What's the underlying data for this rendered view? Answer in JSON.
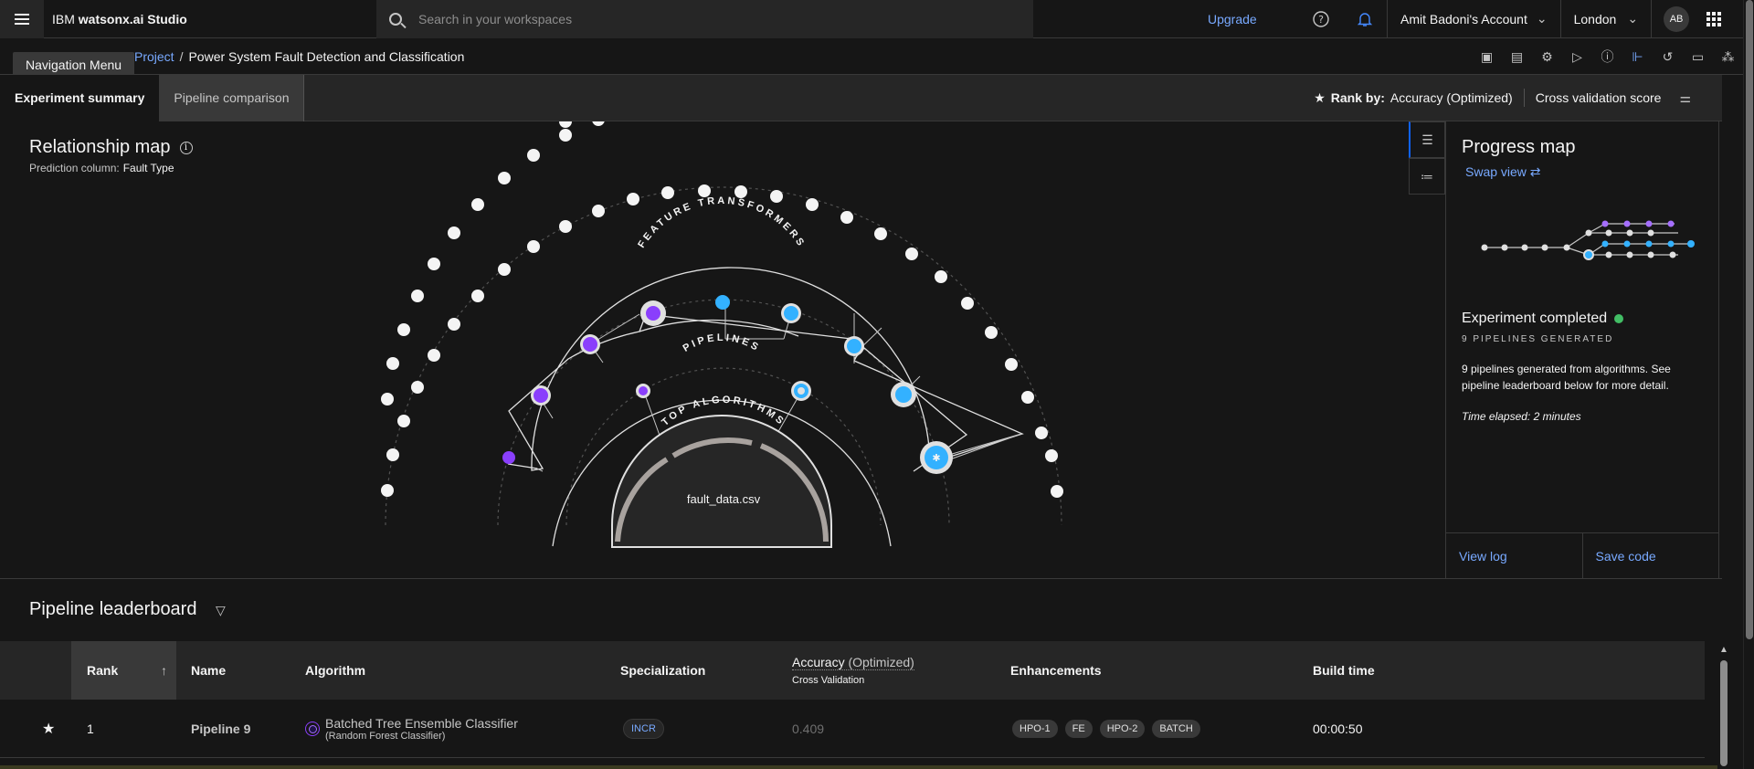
{
  "header": {
    "brand_prefix": "IBM",
    "brand_name": "watsonx.ai Studio",
    "search_placeholder": "Search in your workspaces",
    "upgrade": "Upgrade",
    "account": "Amit Badoni's Account",
    "region": "London",
    "avatar": "AB"
  },
  "tooltip": "Navigation Menu",
  "breadcrumb": {
    "project": "Project",
    "separator": "/",
    "current": "Power System Fault Detection and Classification"
  },
  "tabs": {
    "summary": "Experiment summary",
    "comparison": "Pipeline comparison"
  },
  "rank_by": {
    "label": "Rank by:",
    "metric": "Accuracy (Optimized)",
    "score": "Cross validation score"
  },
  "relationship_map": {
    "title": "Relationship map",
    "prediction_label": "Prediction column:",
    "prediction_value": "Fault Type",
    "ring_feature": "FEATURE TRANSFORMERS",
    "ring_pipelines": "PIPELINES",
    "ring_algorithms": "TOP ALGORITHMS",
    "dataset": "fault_data.csv"
  },
  "progress_map": {
    "title": "Progress map",
    "swap_view": "Swap view ⇄",
    "status": "Experiment completed",
    "pipelines_generated": "9 PIPELINES GENERATED",
    "description": "9 pipelines generated from algorithms. See pipeline leaderboard below for more detail.",
    "elapsed": "Time elapsed: 2 minutes",
    "view_log": "View log",
    "save_code": "Save code"
  },
  "leaderboard": {
    "title": "Pipeline leaderboard",
    "columns": {
      "rank": "Rank",
      "name": "Name",
      "algorithm": "Algorithm",
      "specialization": "Specialization",
      "accuracy": "Accuracy",
      "accuracy_note": "(Optimized)",
      "cross_validation": "Cross Validation",
      "enhancements": "Enhancements",
      "build_time": "Build time"
    },
    "rows": [
      {
        "rank": "1",
        "name": "Pipeline 9",
        "algorithm": "Batched Tree Ensemble Classifier",
        "algorithm_sub": "(Random Forest Classifier)",
        "specialization": "INCR",
        "accuracy": "0.409",
        "enhancements": [
          "HPO-1",
          "FE",
          "HPO-2",
          "BATCH"
        ],
        "build_time": "00:00:50"
      }
    ]
  },
  "colors": {
    "accent": "#78a9ff",
    "purple": "#8a3ffc",
    "blue": "#33b1ff",
    "success": "#42be65"
  }
}
